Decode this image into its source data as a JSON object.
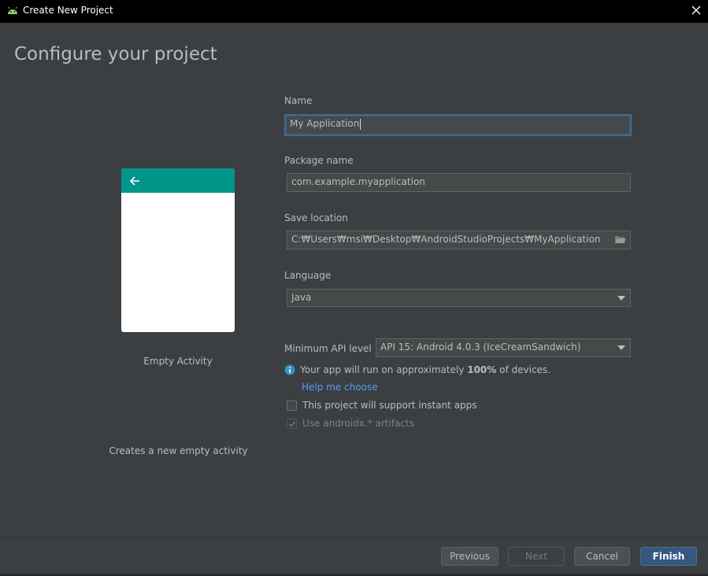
{
  "window": {
    "title": "Create New Project",
    "app_icon": "android-icon",
    "close_icon": "close-icon"
  },
  "page": {
    "title": "Configure your project"
  },
  "template": {
    "name": "Empty Activity",
    "description": "Creates a new empty activity",
    "appbar_color": "#00968a"
  },
  "form": {
    "name_label": "Name",
    "name_value": "My Application",
    "package_label": "Package name",
    "package_value": "com.example.myapplication",
    "save_label": "Save location",
    "save_value": "C:₩Users₩msi₩Desktop₩AndroidStudioProjects₩MyApplication",
    "language_label": "Language",
    "language_value": "Java",
    "min_api_label": "Minimum API level",
    "min_api_value": "API 15: Android 4.0.3 (IceCreamSandwich)",
    "info_prefix": "Your app will run on approximately ",
    "info_percent": "100%",
    "info_suffix": " of devices.",
    "help_link": "Help me choose",
    "instant_apps_label": "This project will support instant apps",
    "instant_apps_checked": false,
    "androidx_label": "Use androidx.* artifacts",
    "androidx_checked": true
  },
  "footer": {
    "previous": "Previous",
    "next": "Next",
    "cancel": "Cancel",
    "finish": "Finish"
  },
  "colors": {
    "background": "#3c3f41",
    "accent": "#365880",
    "link": "#589df6"
  }
}
